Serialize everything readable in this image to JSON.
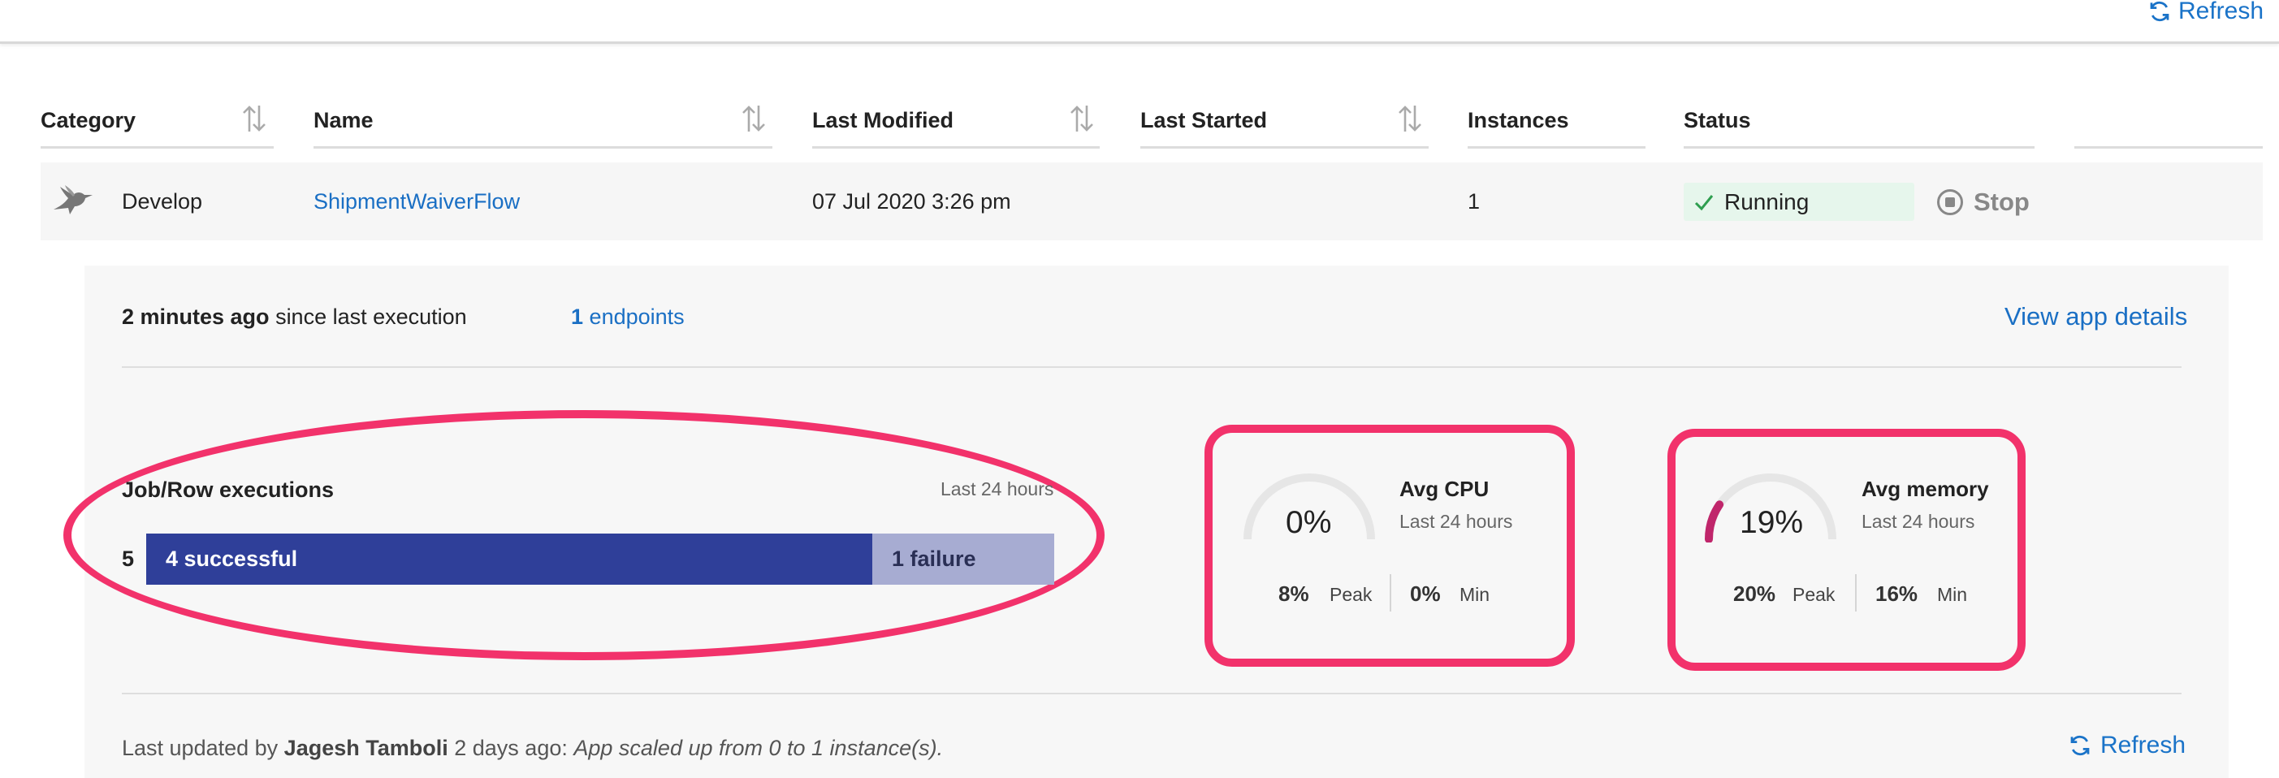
{
  "toolbar": {
    "refresh_label": "Refresh"
  },
  "table": {
    "headers": {
      "category": "Category",
      "name": "Name",
      "last_modified": "Last Modified",
      "last_started": "Last Started",
      "instances": "Instances",
      "status": "Status"
    },
    "row": {
      "category": "Develop",
      "name": "ShipmentWaiverFlow",
      "last_modified": "07 Jul 2020 3:26 pm",
      "last_started": "",
      "instances": "1",
      "status": "Running",
      "stop_label": "Stop"
    }
  },
  "details": {
    "last_exec_time": "2 minutes ago",
    "last_exec_suffix": "since last execution",
    "endpoints_count": "1",
    "endpoints_label": "endpoints",
    "view_details_label": "View app details",
    "executions": {
      "title": "Job/Row executions",
      "period": "Last 24 hours",
      "total": "5",
      "successful_label": "4 successful",
      "failure_label": "1 failure",
      "successful": 4,
      "failures": 1
    },
    "cpu": {
      "title": "Avg CPU",
      "period": "Last 24 hours",
      "value": "0%",
      "fraction": 0.0,
      "peak_value": "8%",
      "peak_label": "Peak",
      "min_value": "0%",
      "min_label": "Min"
    },
    "memory": {
      "title": "Avg memory",
      "period": "Last 24 hours",
      "value": "19%",
      "fraction": 0.19,
      "peak_value": "20%",
      "peak_label": "Peak",
      "min_value": "16%",
      "min_label": "Min"
    },
    "footer": {
      "prefix": "Last updated by",
      "user": "Jagesh Tamboli",
      "when": "2 days ago:",
      "message": "App scaled up from 0 to 1 instance(s).",
      "refresh_label": "Refresh"
    }
  },
  "colors": {
    "accent_link": "#1a6fc4",
    "success_bar": "#2f3f99",
    "failure_bar": "#a7acd2",
    "running_bg": "#e6f6ec",
    "running_check": "#2e9e4f",
    "highlight": "#f2326b",
    "memory_arc": "#c0266b",
    "gauge_track": "#e6e6e6"
  },
  "icons": {
    "category": "hummingbird-icon",
    "sort": "sort-arrows-icon",
    "status": "check-icon",
    "stop": "stop-circle-icon",
    "refresh": "refresh-icon"
  }
}
